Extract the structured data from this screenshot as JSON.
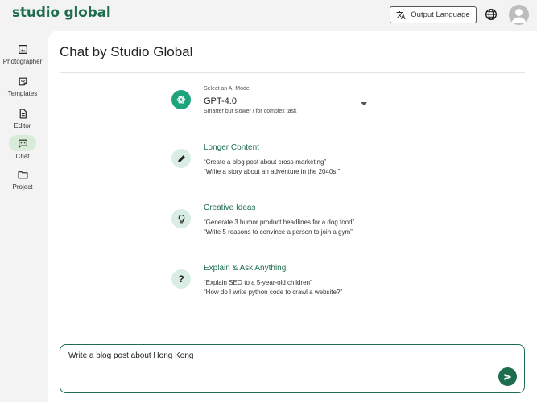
{
  "app": {
    "logo": "studio global"
  },
  "header": {
    "output_language_label": "Output Language"
  },
  "sidebar": {
    "items": [
      {
        "label": "Photographer",
        "icon": "image-icon"
      },
      {
        "label": "Templates",
        "icon": "templates-icon"
      },
      {
        "label": "Editor",
        "icon": "document-icon"
      },
      {
        "label": "Chat",
        "icon": "chat-icon",
        "active": true
      },
      {
        "label": "Project",
        "icon": "folder-icon"
      }
    ]
  },
  "main": {
    "title": "Chat by Studio Global",
    "model": {
      "label": "Select an AI Model",
      "value": "GPT-4.0",
      "helper": "Smarter but slower / for complex task"
    },
    "suggestions": [
      {
        "title": "Longer Content",
        "icon": "pencil-icon",
        "examples": [
          "“Create a blog post about cross-marketing”",
          "“Write a story about an adventure in the 2040s.”"
        ]
      },
      {
        "title": "Creative Ideas",
        "icon": "lightbulb-icon",
        "examples": [
          "“Generate 3 humor product headlines for a dog food”",
          "“Write 5 reasons to convince a person to join a gym”"
        ]
      },
      {
        "title": "Explain & Ask Anything",
        "icon": "question-icon",
        "examples": [
          "“Explain SEO to a 5-year-old children”",
          "“How do I write python code to crawl a website?”"
        ]
      }
    ],
    "input": {
      "value": "Write a blog post about Hong Kong"
    }
  },
  "colors": {
    "brand": "#1e6e4e",
    "openai": "#1fa37a",
    "active_nav": "#d9ecd9"
  }
}
